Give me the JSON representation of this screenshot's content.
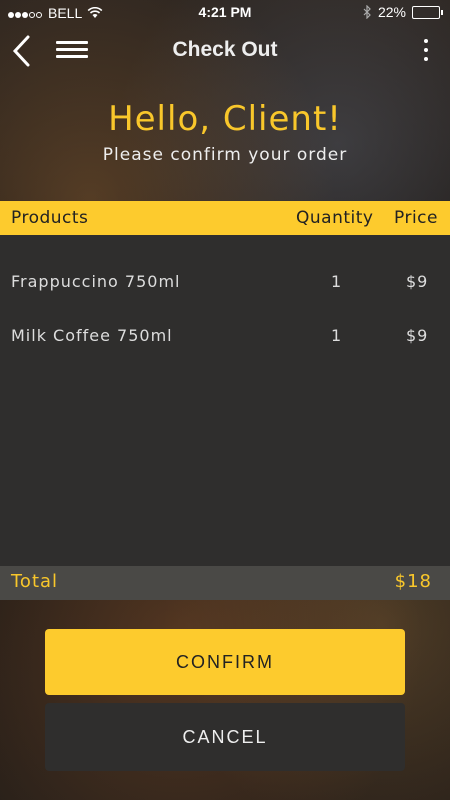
{
  "status_bar": {
    "carrier": "BELL",
    "time": "4:21 PM",
    "battery": "22%",
    "battery_level": 0.22,
    "signal_bars": 3
  },
  "navbar": {
    "title": "Check Out",
    "back_icon": "chevron-left-icon",
    "menu_icon": "hamburger-menu-icon",
    "more_icon": "vertical-dots-icon"
  },
  "greeting": {
    "title": "Hello, Client!",
    "subtitle": "Please confirm your order"
  },
  "table": {
    "headers": {
      "products": "Products",
      "quantity": "Quantity",
      "price": "Price"
    },
    "rows": [
      {
        "product": "Frappuccino 750ml",
        "quantity": "1",
        "price": "$9"
      },
      {
        "product": "Milk Coffee 750ml",
        "quantity": "1",
        "price": "$9"
      }
    ],
    "total_label": "Total",
    "total_value": "$18"
  },
  "actions": {
    "confirm_label": "CONFIRM",
    "cancel_label": "CANCEL"
  },
  "colors": {
    "accent": "#fdcb2d",
    "panel": "#2f2e2d",
    "total_bar": "#4a4946"
  }
}
